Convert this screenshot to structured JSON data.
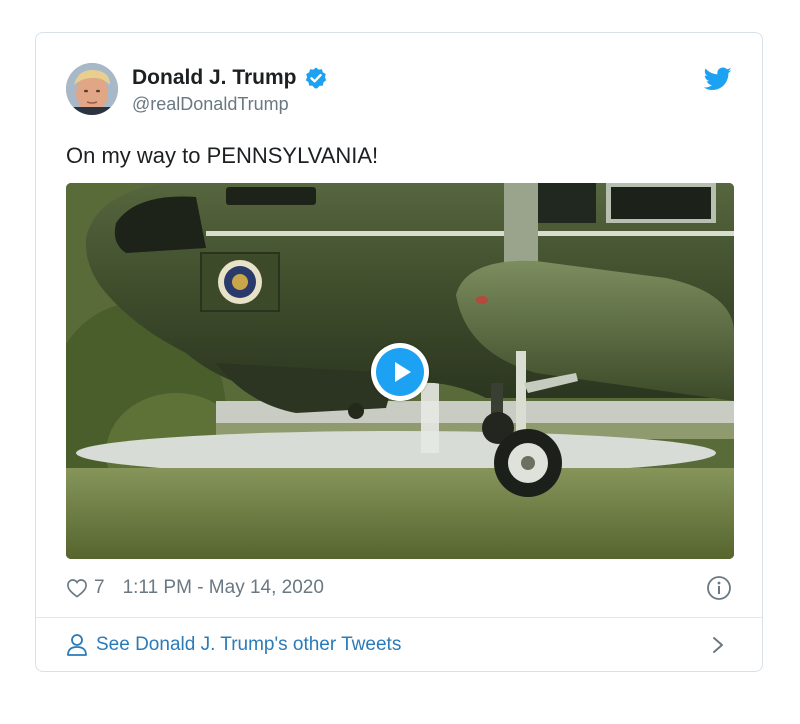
{
  "tweet": {
    "display_name": "Donald J. Trump",
    "handle": "@realDonaldTrump",
    "text": "On my way to PENNSYLVANIA!",
    "likes": "7",
    "timestamp": "1:11 PM - May 14, 2020",
    "see_more": "See Donald J. Trump's other Tweets"
  },
  "icons": {
    "verified": "verified-badge-icon",
    "twitter": "twitter-bird-icon",
    "heart": "heart-icon",
    "info": "info-icon",
    "person": "person-icon",
    "chevron": "chevron-right-icon",
    "play": "play-icon"
  },
  "colors": {
    "accent": "#1da1f2",
    "link": "#2b7bb9",
    "muted": "#697882",
    "text": "#1c2022",
    "border": "#d9e1e8"
  }
}
